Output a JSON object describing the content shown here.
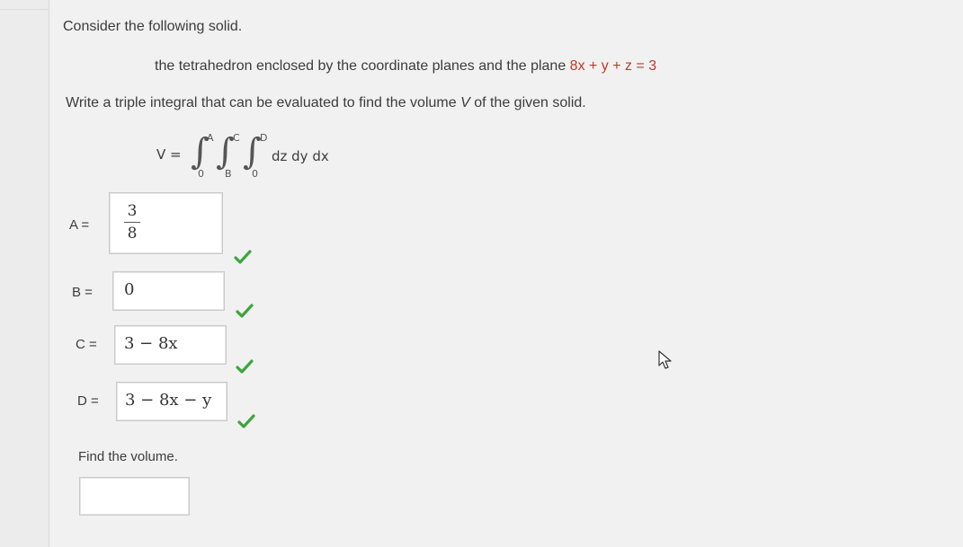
{
  "problem": {
    "intro": "Consider the following solid.",
    "solid_prefix": "the tetrahedron enclosed by the coordinate planes and the plane ",
    "plane_equation": "8x + y + z = 3",
    "instruction_prefix": "Write a triple integral that can be evaluated to find the volume ",
    "instruction_var": "V",
    "instruction_suffix": " of the given solid."
  },
  "formula": {
    "lhs": "V =",
    "upper_limits": [
      "A",
      "C",
      "D"
    ],
    "lower_limits": [
      "0",
      "B",
      "0"
    ],
    "differentials": "dz dy dx"
  },
  "answers": [
    {
      "label": "A  =",
      "numerator": "3",
      "denominator": "8",
      "correct": true
    },
    {
      "label": "B  =",
      "value": "0",
      "correct": true
    },
    {
      "label": "C  =",
      "value": "3 − 8x",
      "correct": true
    },
    {
      "label": "D  =",
      "value": "3 − 8x − y",
      "correct": true
    }
  ],
  "volume": {
    "prompt": "Find the volume.",
    "value": ""
  },
  "colors": {
    "accent_red": "#c0392b",
    "check_green": "#3ca63c"
  }
}
